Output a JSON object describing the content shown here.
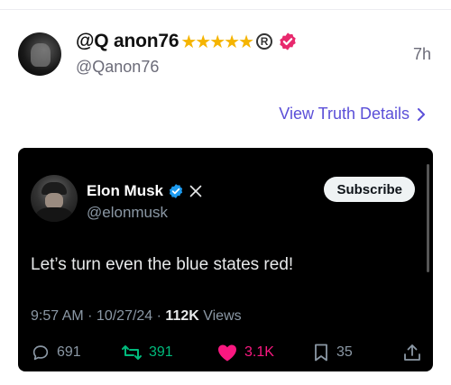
{
  "post": {
    "display_name": "@Q anon76",
    "stars": "★★★★★",
    "registered_mark": "R",
    "handle": "@Qanon76",
    "time": "7h",
    "view_details": "View Truth Details",
    "avatar_icon": "user-avatar"
  },
  "tweet": {
    "name": "Elon Musk",
    "handle": "@elonmusk",
    "subscribe_label": "Subscribe",
    "text": "Let’s turn even the blue states red!",
    "timestamp": "9:57 AM · 10/27/24 · ",
    "views_count": "112K",
    "views_label": " Views",
    "actions": {
      "replies": "691",
      "reposts": "391",
      "likes": "3.1K",
      "bookmarks": "35"
    },
    "colors": {
      "verified": "#1d9bf0",
      "repost": "#00ba7c",
      "like": "#f91880"
    }
  },
  "colors": {
    "link": "#5b4fd8",
    "star": "#f5b400",
    "pink_badge": "#e8296d"
  }
}
